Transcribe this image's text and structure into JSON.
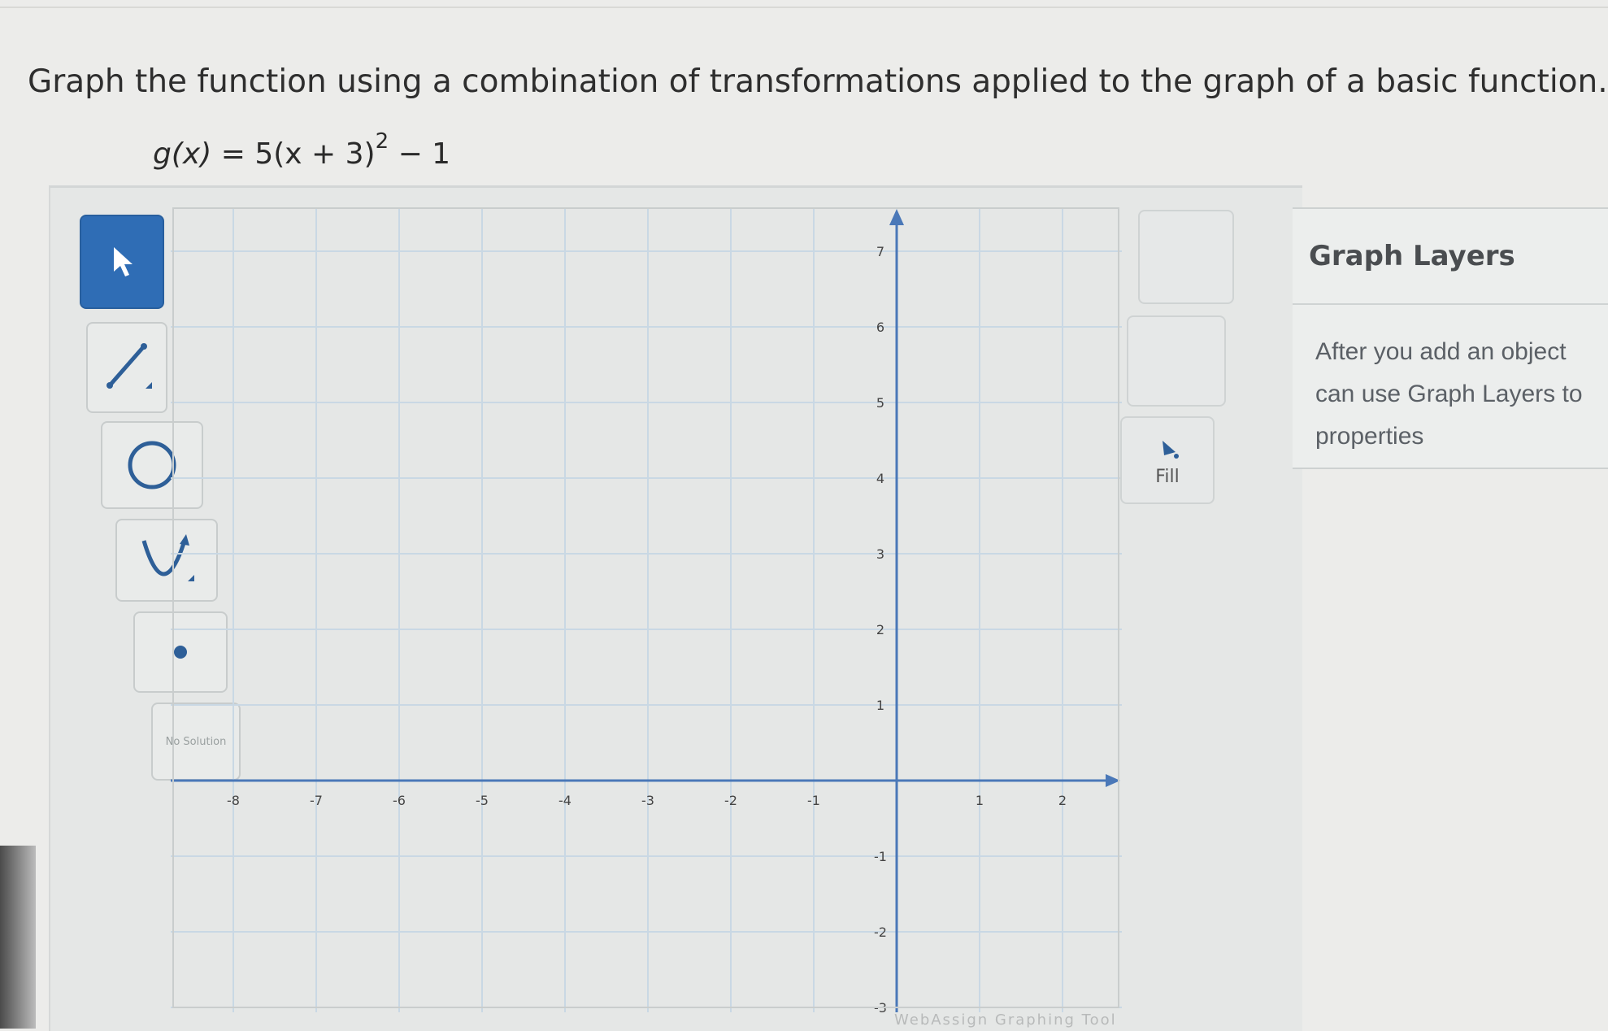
{
  "question": "Graph the function using a combination of transformations applied to the graph of a basic function.",
  "equation": {
    "lhs": "g(x)",
    "rhs_main": "5(x + 3)",
    "exponent": "2",
    "rhs_tail": " − 1"
  },
  "toolbar": {
    "tools": [
      "pointer",
      "line",
      "circle",
      "parabola",
      "point",
      "no-solution"
    ],
    "active_tool": "pointer",
    "no_solution_label": "No Solution"
  },
  "side_buttons": {
    "fill_label": "Fill"
  },
  "graph": {
    "x_ticks": [
      "-8",
      "-7",
      "-6",
      "-5",
      "-4",
      "-3",
      "-2",
      "-1",
      "1",
      "2"
    ],
    "y_ticks_pos": [
      "7",
      "6",
      "5",
      "4",
      "3",
      "2",
      "1"
    ],
    "y_ticks_neg": [
      "-1",
      "-2",
      "-3"
    ]
  },
  "layers": {
    "title": "Graph Layers",
    "text": "After you add an object can use Graph Layers to properties"
  },
  "footer": "WebAssign Graphing Tool",
  "colors": {
    "active_tool": "#2f6db5",
    "grid": "#c9d8e4",
    "axis": "#4a78b8"
  }
}
